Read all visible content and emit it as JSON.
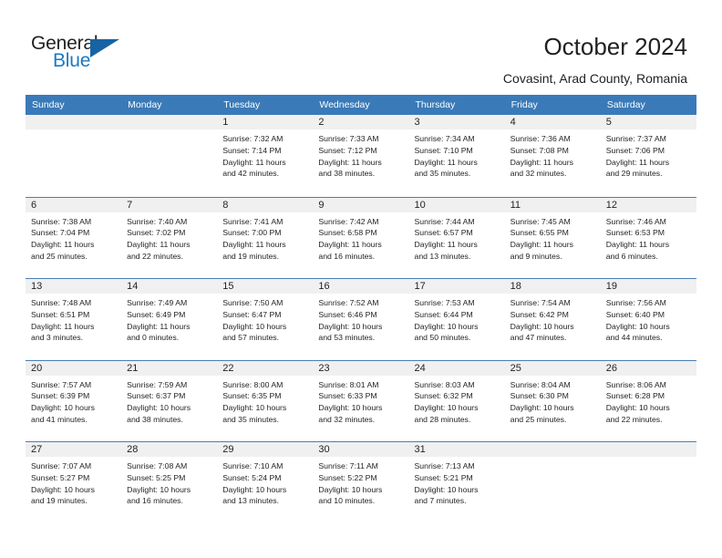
{
  "brand": {
    "name_part1": "General",
    "name_part2": "Blue",
    "accent_color": "#1763a4",
    "text_color": "#231f20"
  },
  "header": {
    "title": "October 2024",
    "location": "Covasint, Arad County, Romania"
  },
  "calendar": {
    "header_bg": "#3a7ab8",
    "band_bg": "#f0f0f0",
    "weekdays": [
      "Sunday",
      "Monday",
      "Tuesday",
      "Wednesday",
      "Thursday",
      "Friday",
      "Saturday"
    ],
    "weeks": [
      [
        {
          "day": "",
          "lines": []
        },
        {
          "day": "",
          "lines": []
        },
        {
          "day": "1",
          "lines": [
            "Sunrise: 7:32 AM",
            "Sunset: 7:14 PM",
            "Daylight: 11 hours",
            "and 42 minutes."
          ]
        },
        {
          "day": "2",
          "lines": [
            "Sunrise: 7:33 AM",
            "Sunset: 7:12 PM",
            "Daylight: 11 hours",
            "and 38 minutes."
          ]
        },
        {
          "day": "3",
          "lines": [
            "Sunrise: 7:34 AM",
            "Sunset: 7:10 PM",
            "Daylight: 11 hours",
            "and 35 minutes."
          ]
        },
        {
          "day": "4",
          "lines": [
            "Sunrise: 7:36 AM",
            "Sunset: 7:08 PM",
            "Daylight: 11 hours",
            "and 32 minutes."
          ]
        },
        {
          "day": "5",
          "lines": [
            "Sunrise: 7:37 AM",
            "Sunset: 7:06 PM",
            "Daylight: 11 hours",
            "and 29 minutes."
          ]
        }
      ],
      [
        {
          "day": "6",
          "lines": [
            "Sunrise: 7:38 AM",
            "Sunset: 7:04 PM",
            "Daylight: 11 hours",
            "and 25 minutes."
          ]
        },
        {
          "day": "7",
          "lines": [
            "Sunrise: 7:40 AM",
            "Sunset: 7:02 PM",
            "Daylight: 11 hours",
            "and 22 minutes."
          ]
        },
        {
          "day": "8",
          "lines": [
            "Sunrise: 7:41 AM",
            "Sunset: 7:00 PM",
            "Daylight: 11 hours",
            "and 19 minutes."
          ]
        },
        {
          "day": "9",
          "lines": [
            "Sunrise: 7:42 AM",
            "Sunset: 6:58 PM",
            "Daylight: 11 hours",
            "and 16 minutes."
          ]
        },
        {
          "day": "10",
          "lines": [
            "Sunrise: 7:44 AM",
            "Sunset: 6:57 PM",
            "Daylight: 11 hours",
            "and 13 minutes."
          ]
        },
        {
          "day": "11",
          "lines": [
            "Sunrise: 7:45 AM",
            "Sunset: 6:55 PM",
            "Daylight: 11 hours",
            "and 9 minutes."
          ]
        },
        {
          "day": "12",
          "lines": [
            "Sunrise: 7:46 AM",
            "Sunset: 6:53 PM",
            "Daylight: 11 hours",
            "and 6 minutes."
          ]
        }
      ],
      [
        {
          "day": "13",
          "lines": [
            "Sunrise: 7:48 AM",
            "Sunset: 6:51 PM",
            "Daylight: 11 hours",
            "and 3 minutes."
          ]
        },
        {
          "day": "14",
          "lines": [
            "Sunrise: 7:49 AM",
            "Sunset: 6:49 PM",
            "Daylight: 11 hours",
            "and 0 minutes."
          ]
        },
        {
          "day": "15",
          "lines": [
            "Sunrise: 7:50 AM",
            "Sunset: 6:47 PM",
            "Daylight: 10 hours",
            "and 57 minutes."
          ]
        },
        {
          "day": "16",
          "lines": [
            "Sunrise: 7:52 AM",
            "Sunset: 6:46 PM",
            "Daylight: 10 hours",
            "and 53 minutes."
          ]
        },
        {
          "day": "17",
          "lines": [
            "Sunrise: 7:53 AM",
            "Sunset: 6:44 PM",
            "Daylight: 10 hours",
            "and 50 minutes."
          ]
        },
        {
          "day": "18",
          "lines": [
            "Sunrise: 7:54 AM",
            "Sunset: 6:42 PM",
            "Daylight: 10 hours",
            "and 47 minutes."
          ]
        },
        {
          "day": "19",
          "lines": [
            "Sunrise: 7:56 AM",
            "Sunset: 6:40 PM",
            "Daylight: 10 hours",
            "and 44 minutes."
          ]
        }
      ],
      [
        {
          "day": "20",
          "lines": [
            "Sunrise: 7:57 AM",
            "Sunset: 6:39 PM",
            "Daylight: 10 hours",
            "and 41 minutes."
          ]
        },
        {
          "day": "21",
          "lines": [
            "Sunrise: 7:59 AM",
            "Sunset: 6:37 PM",
            "Daylight: 10 hours",
            "and 38 minutes."
          ]
        },
        {
          "day": "22",
          "lines": [
            "Sunrise: 8:00 AM",
            "Sunset: 6:35 PM",
            "Daylight: 10 hours",
            "and 35 minutes."
          ]
        },
        {
          "day": "23",
          "lines": [
            "Sunrise: 8:01 AM",
            "Sunset: 6:33 PM",
            "Daylight: 10 hours",
            "and 32 minutes."
          ]
        },
        {
          "day": "24",
          "lines": [
            "Sunrise: 8:03 AM",
            "Sunset: 6:32 PM",
            "Daylight: 10 hours",
            "and 28 minutes."
          ]
        },
        {
          "day": "25",
          "lines": [
            "Sunrise: 8:04 AM",
            "Sunset: 6:30 PM",
            "Daylight: 10 hours",
            "and 25 minutes."
          ]
        },
        {
          "day": "26",
          "lines": [
            "Sunrise: 8:06 AM",
            "Sunset: 6:28 PM",
            "Daylight: 10 hours",
            "and 22 minutes."
          ]
        }
      ],
      [
        {
          "day": "27",
          "lines": [
            "Sunrise: 7:07 AM",
            "Sunset: 5:27 PM",
            "Daylight: 10 hours",
            "and 19 minutes."
          ]
        },
        {
          "day": "28",
          "lines": [
            "Sunrise: 7:08 AM",
            "Sunset: 5:25 PM",
            "Daylight: 10 hours",
            "and 16 minutes."
          ]
        },
        {
          "day": "29",
          "lines": [
            "Sunrise: 7:10 AM",
            "Sunset: 5:24 PM",
            "Daylight: 10 hours",
            "and 13 minutes."
          ]
        },
        {
          "day": "30",
          "lines": [
            "Sunrise: 7:11 AM",
            "Sunset: 5:22 PM",
            "Daylight: 10 hours",
            "and 10 minutes."
          ]
        },
        {
          "day": "31",
          "lines": [
            "Sunrise: 7:13 AM",
            "Sunset: 5:21 PM",
            "Daylight: 10 hours",
            "and 7 minutes."
          ]
        },
        {
          "day": "",
          "lines": []
        },
        {
          "day": "",
          "lines": []
        }
      ]
    ]
  }
}
